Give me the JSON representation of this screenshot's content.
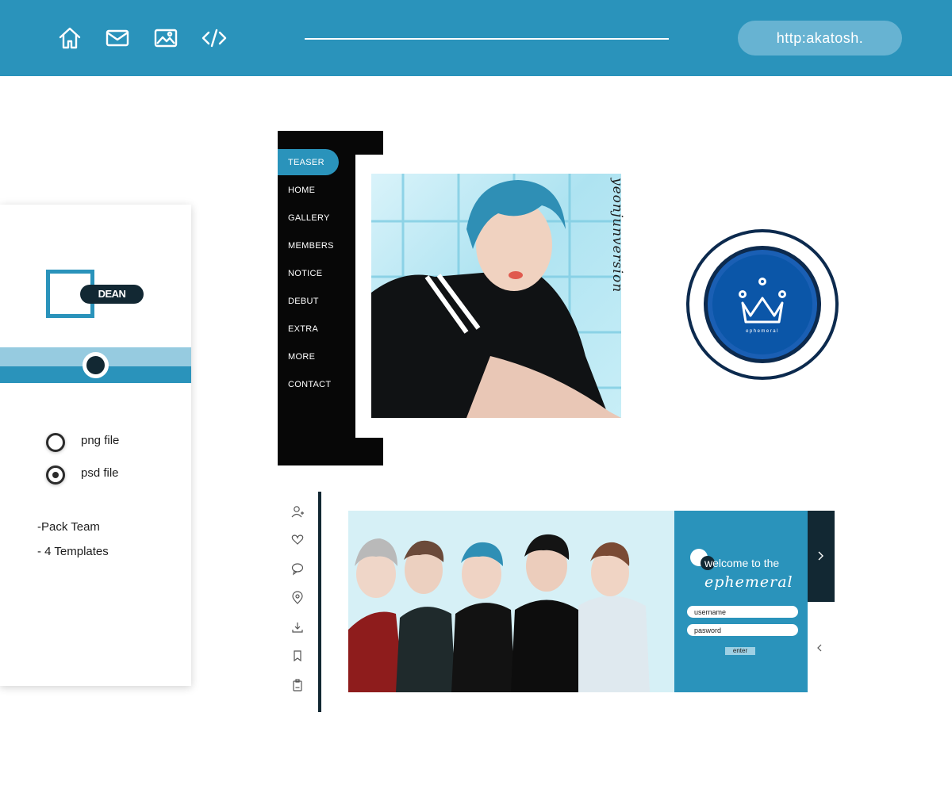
{
  "topbar": {
    "icons": [
      "home-icon",
      "mail-icon",
      "image-icon",
      "code-icon"
    ],
    "url_label": "http:akatosh.",
    "color": "#2a93bb"
  },
  "card": {
    "logo_text": "DEAN",
    "slider_value": 0.5,
    "options": [
      {
        "label": "png file",
        "selected": false
      },
      {
        "label": "psd file",
        "selected": true
      }
    ],
    "pack_lines": [
      "-Pack Team",
      "- 4 Templates"
    ]
  },
  "teaser": {
    "menu": [
      "TEASER",
      "HOME",
      "GALLERY",
      "MEMBERS",
      "NOTICE",
      "DEBUT",
      "EXTRA",
      "MORE",
      "CONTACT"
    ],
    "active_item": "TEASER",
    "signature": "yeonjunversion"
  },
  "logo": {
    "icon": "crown-icon",
    "caption": "ephemeral"
  },
  "login": {
    "side_icons": [
      "user-add-icon",
      "heart-icon",
      "chat-icon",
      "location-icon",
      "download-icon",
      "bookmark-icon",
      "clipboard-icon"
    ],
    "welcome": "welcome to the",
    "brand": "ephemeral",
    "username_placeholder": "username",
    "password_placeholder": "pasword",
    "enter_label": "enter"
  },
  "colors": {
    "accent": "#2a93bb",
    "dark": "#122833",
    "light": "#96cbe0"
  }
}
